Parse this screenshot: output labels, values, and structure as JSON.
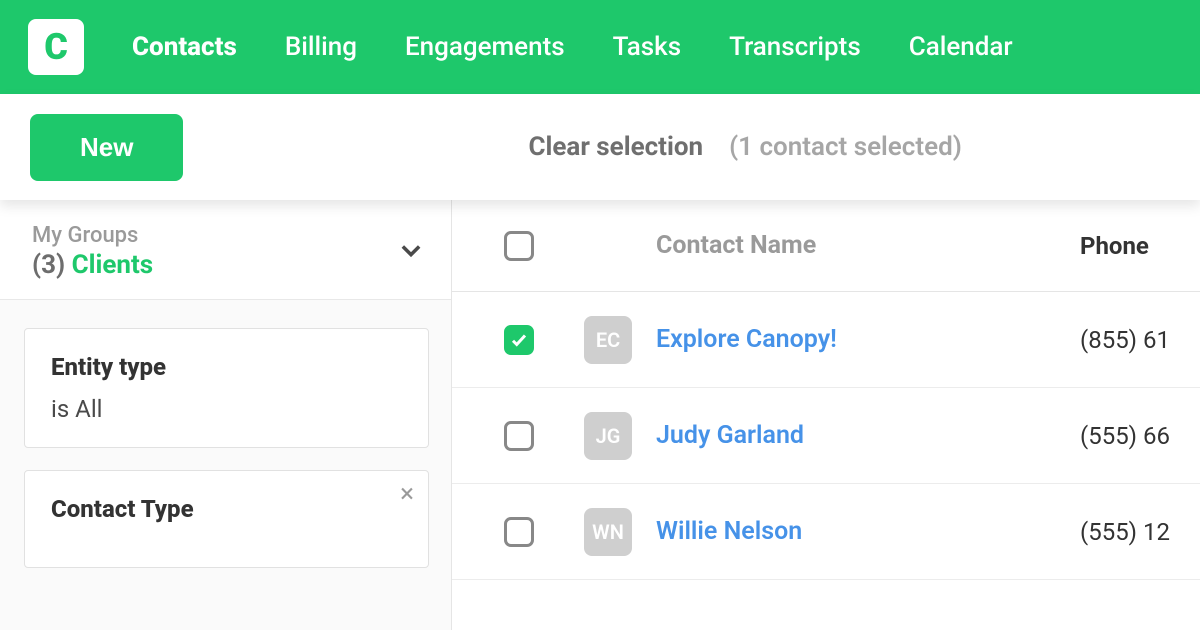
{
  "brand": {
    "letter": "C"
  },
  "nav": {
    "items": [
      {
        "label": "Contacts",
        "active": true
      },
      {
        "label": "Billing",
        "active": false
      },
      {
        "label": "Engagements",
        "active": false
      },
      {
        "label": "Tasks",
        "active": false
      },
      {
        "label": "Transcripts",
        "active": false
      },
      {
        "label": "Calendar",
        "active": false
      }
    ]
  },
  "toolbar": {
    "new_label": "New",
    "clear_label": "Clear selection",
    "selected_text": "(1 contact selected)"
  },
  "sidebar": {
    "group_label": "My Groups",
    "group_count": "(3)",
    "group_name": "Clients",
    "filters": [
      {
        "title": "Entity type",
        "value": "is All",
        "closable": false
      },
      {
        "title": "Contact Type",
        "value": "",
        "closable": true
      }
    ]
  },
  "table": {
    "headers": {
      "name": "Contact Name",
      "phone": "Phone"
    },
    "rows": [
      {
        "initials": "EC",
        "name": "Explore Canopy!",
        "phone": "(855) 61",
        "checked": true
      },
      {
        "initials": "JG",
        "name": "Judy Garland",
        "phone": "(555) 66",
        "checked": false
      },
      {
        "initials": "WN",
        "name": "Willie Nelson",
        "phone": "(555) 12",
        "checked": false
      }
    ]
  }
}
